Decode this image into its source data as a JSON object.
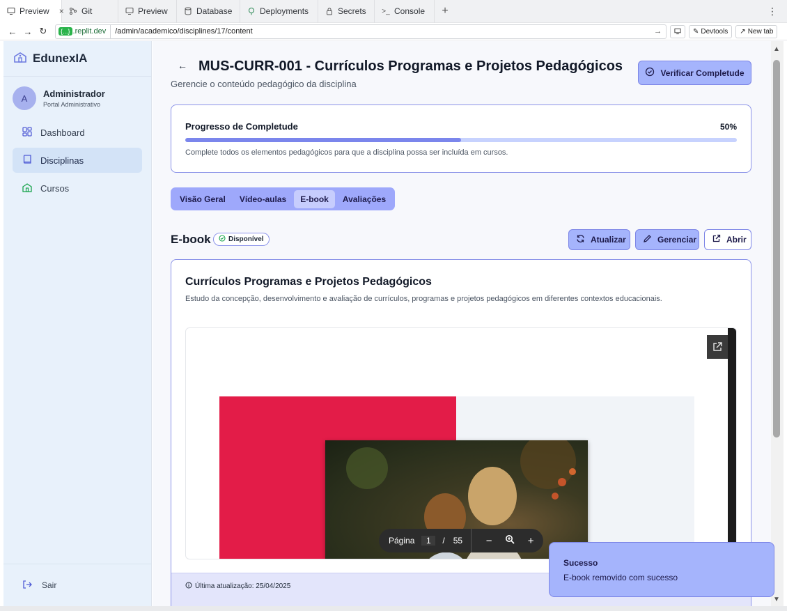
{
  "browser": {
    "tabs": [
      {
        "label": "Preview",
        "icon": "monitor-icon",
        "active": true
      },
      {
        "label": "Git",
        "icon": "git-icon"
      },
      {
        "label": "Preview",
        "icon": "monitor-icon"
      },
      {
        "label": "Database",
        "icon": "database-icon"
      },
      {
        "label": "Deployments",
        "icon": "deploy-icon"
      },
      {
        "label": "Secrets",
        "icon": "lock-icon"
      },
      {
        "label": "Console",
        "icon": "terminal-icon"
      }
    ],
    "close_glyph": "×",
    "new_tab_glyph": "+",
    "host_badge": "{...}",
    "host": ".replit.dev",
    "path": "/admin/academico/disciplines/17/content",
    "devtools_label": "Devtools",
    "newtab_label": "New tab"
  },
  "sidebar": {
    "brand": "EdunexIA",
    "user_initial": "A",
    "user_name": "Administrador",
    "user_role": "Portal Administrativo",
    "items": [
      {
        "label": "Dashboard",
        "icon": "dashboard-icon"
      },
      {
        "label": "Disciplinas",
        "icon": "book-icon",
        "active": true
      },
      {
        "label": "Cursos",
        "icon": "school-icon"
      }
    ],
    "logout_label": "Sair"
  },
  "header": {
    "back_glyph": "←",
    "title": "MUS-CURR-001 - Currículos Programas e Projetos Pedagógicos",
    "subtitle": "Gerencie o conteúdo pedagógico da disciplina",
    "verify_label": "Verificar Completude"
  },
  "progress": {
    "title": "Progresso de Completude",
    "percent_label": "50%",
    "value": 0.5,
    "note": "Complete todos os elementos pedagógicos para que a disciplina possa ser incluída em cursos."
  },
  "content_tabs": [
    {
      "label": "Visão Geral"
    },
    {
      "label": "Vídeo-aulas"
    },
    {
      "label": "E-book",
      "active": true
    },
    {
      "label": "Avaliações"
    }
  ],
  "ebook": {
    "section_title": "E-book",
    "status_badge": "Disponível",
    "refresh_label": "Atualizar",
    "manage_label": "Gerenciar",
    "open_label": "Abrir",
    "title": "Currículos Programas e Projetos Pedagógicos",
    "description": "Estudo da concepção, desenvolvimento e avaliação de currículos, programas e projetos pedagógicos em diferentes contextos educacionais.",
    "viewer": {
      "page_label": "Página",
      "current_page": "1",
      "separator": "/",
      "total_pages": "55",
      "zoom_out": "−",
      "zoom_in": "+"
    },
    "last_updated": "Última atualização: 25/04/2025"
  },
  "toast": {
    "title": "Sucesso",
    "message": "E-book removido com sucesso"
  },
  "colors": {
    "accent": "#a5b4fc",
    "accent_border": "#7c85e6",
    "sidebar_bg": "#e8f1fb",
    "cover_red": "#e31c48"
  }
}
